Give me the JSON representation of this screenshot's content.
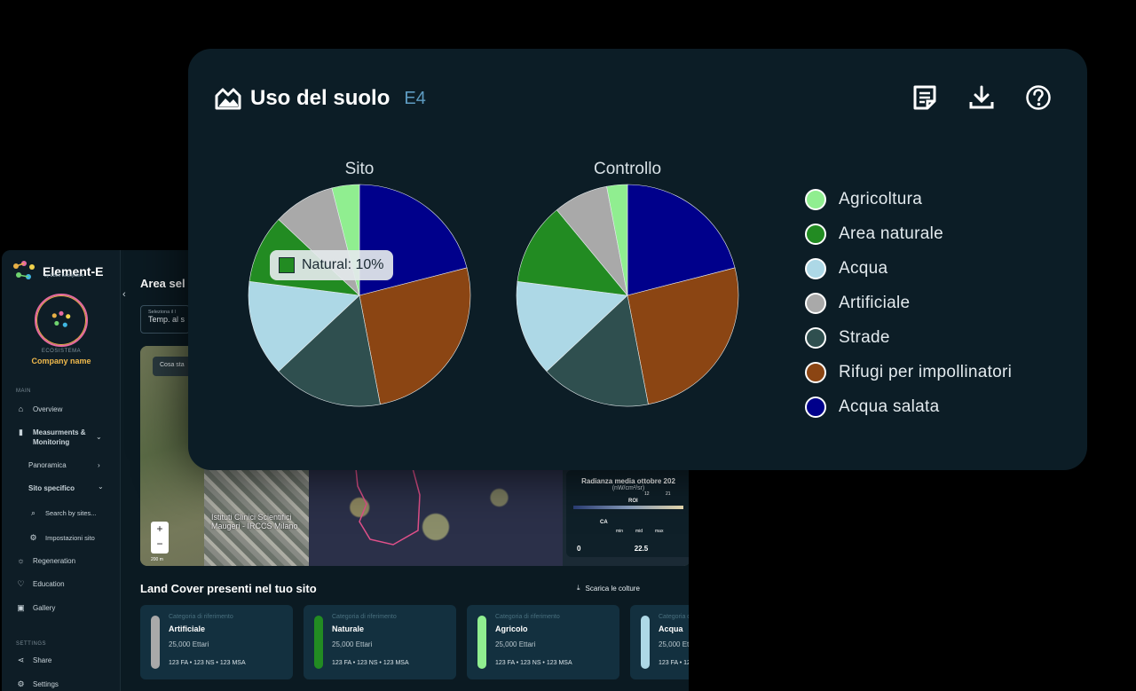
{
  "app": {
    "brand_name": "Element-E",
    "brand_sub": "by 3Bee Ecosystem",
    "eco_label": "ECOSISTEMA",
    "company": "Company name",
    "sections": {
      "main": "MAIN",
      "settings": "SETTINGS"
    },
    "nav": {
      "overview": "Overview",
      "measurements": "Measurments &",
      "measurements2": "Monitoring",
      "panoramica": "Panoramica",
      "sito_specifico": "Sito specifico",
      "search": "Search by sites...",
      "impostazioni": "Impostazioni sito",
      "regeneration": "Regeneration",
      "education": "Education",
      "gallery": "Gallery",
      "share": "Share",
      "settings": "Settings"
    },
    "main": {
      "area_title": "Area sel",
      "select_label": "Seleziona il l",
      "select_value": "Temp. al s",
      "map_pill": "Cosa sta",
      "map_place_1": "Istituti Clinici Scientifici",
      "map_place_2": "Maugeri - IRCCS Milano",
      "zoom_in": "+",
      "zoom_out": "−",
      "scale": "200 m",
      "radiance_title": "Radianza media ottobre 202",
      "radiance_unit": "(nW/cm²/sr)",
      "roi": "ROI",
      "ca": "CA",
      "tick_12": "12",
      "tick_21": "21",
      "tick_min": "min",
      "tick_mid": "mid",
      "tick_max": "max",
      "val_0": "0",
      "val_22": "22.5",
      "lc_title": "Land Cover presenti nel tuo sito",
      "download": "Scarica le colture",
      "cards": [
        {
          "cat": "Categoria di riferimento",
          "name": "Artificiale",
          "ha": "25,000 Ettari",
          "stats": "123 FA  •  123 NS  •  123 MSA",
          "color": "#a9a9a9"
        },
        {
          "cat": "Categoria di riferimento",
          "name": "Naturale",
          "ha": "25,000 Ettari",
          "stats": "123 FA  •  123 NS  •  123 MSA",
          "color": "#228b22"
        },
        {
          "cat": "Categoria di riferimento",
          "name": "Agricolo",
          "ha": "25,000 Ettari",
          "stats": "123 FA  •  123 NS  •  123 MSA",
          "color": "#90ee90"
        },
        {
          "cat": "Categoria di riferimento",
          "name": "Acqua",
          "ha": "25,000 Ettari",
          "stats": "123 FA  •  123 NS  •  123 MSA",
          "color": "#add8e6"
        }
      ]
    }
  },
  "panel": {
    "title": "Uso del suolo",
    "code": "E4",
    "icons": [
      "notes-icon",
      "download-icon",
      "help-icon"
    ],
    "tooltip": "Natural: 10%"
  },
  "chart_data": [
    {
      "type": "pie",
      "title": "Sito",
      "categories": [
        "Acqua salata",
        "Rifugi per impollinatori",
        "Strade",
        "Acqua",
        "Area naturale",
        "Artificiale",
        "Agricoltura"
      ],
      "values": [
        21,
        26,
        16,
        14,
        10,
        9,
        4
      ],
      "colors": [
        "#00008b",
        "#8b4513",
        "#2f4f4f",
        "#add8e6",
        "#228b22",
        "#a9a9a9",
        "#90ee90"
      ]
    },
    {
      "type": "pie",
      "title": "Controllo",
      "categories": [
        "Acqua salata",
        "Rifugi per impollinatori",
        "Strade",
        "Acqua",
        "Area naturale",
        "Artificiale",
        "Agricoltura"
      ],
      "values": [
        21,
        26,
        16,
        14,
        12,
        8,
        3
      ],
      "colors": [
        "#00008b",
        "#8b4513",
        "#2f4f4f",
        "#add8e6",
        "#228b22",
        "#a9a9a9",
        "#90ee90"
      ]
    }
  ],
  "legend": [
    {
      "label": "Agricoltura",
      "color": "#90ee90"
    },
    {
      "label": "Area naturale",
      "color": "#228b22"
    },
    {
      "label": "Acqua",
      "color": "#add8e6"
    },
    {
      "label": "Artificiale",
      "color": "#a9a9a9"
    },
    {
      "label": "Strade",
      "color": "#2f4f4f"
    },
    {
      "label": "Rifugi per impollinatori",
      "color": "#8b4513"
    },
    {
      "label": "Acqua salata",
      "color": "#00008b"
    }
  ]
}
